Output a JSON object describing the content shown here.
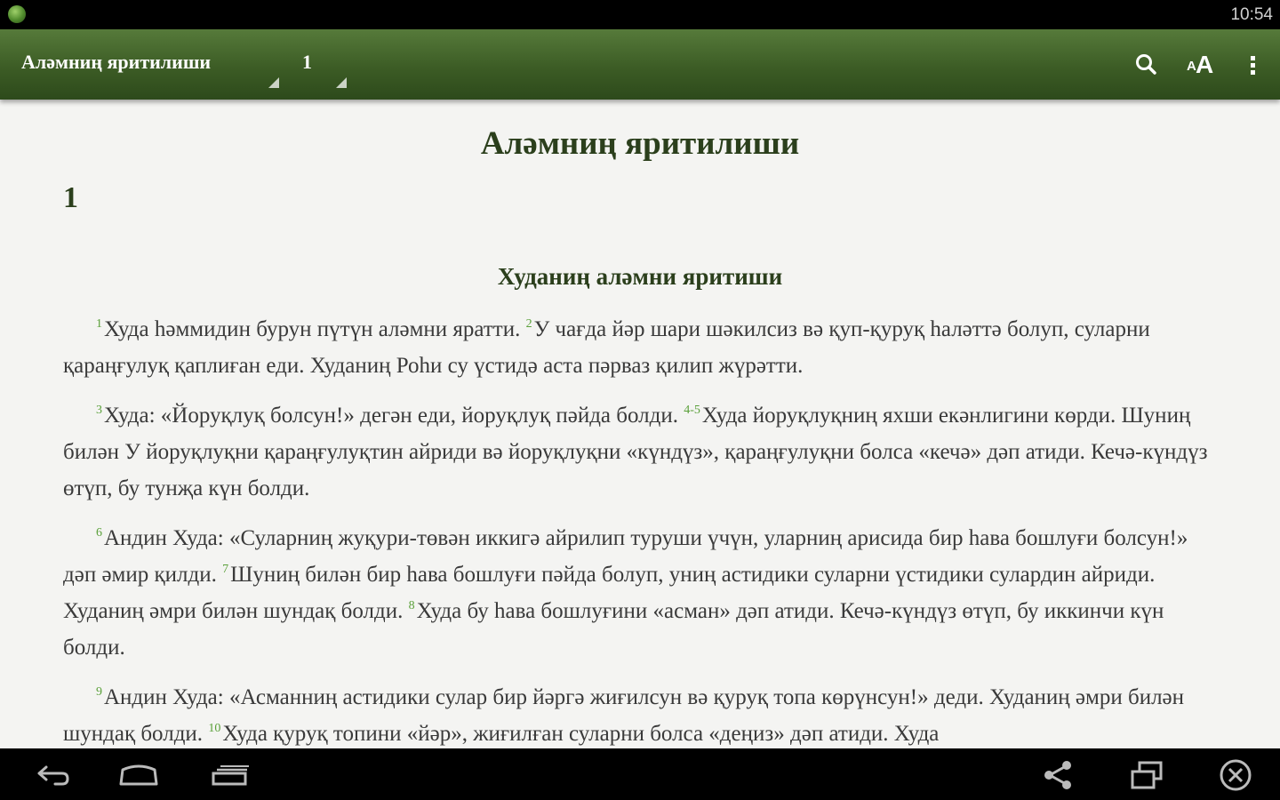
{
  "status_bar": {
    "time": "10:54"
  },
  "action_bar": {
    "book_selector": "Аләмниң яритилиши",
    "chapter_selector": "1"
  },
  "content": {
    "book_title": "Аләмниң яритилиши",
    "chapter": "1",
    "section_heading": "Худаниң аләмни яритиши",
    "paragraphs": [
      [
        {
          "v": "1",
          "t": "Худа һәммидин бурун пүтүн аләмни яратти. "
        },
        {
          "v": "2",
          "t": "У чағда йәр шари шәкилсиз вә қуп-қуруқ һаләттә болуп, суларни қараңғулуқ қаплиған еди. Худаниң Роһи су үстидә аста пәрваз қилип жүрәтти."
        }
      ],
      [
        {
          "v": "3",
          "t": "Худа: «Йоруқлуқ болсун!» дегән еди, йоруқлуқ пәйда болди. "
        },
        {
          "v": "4-5",
          "t": "Худа йоруқлуқниң яхши екәнлигини көрди. Шуниң билән У йоруқлуқни қараңғулуқтин айриди вә йоруқлуқни «күндүз», қараңғулуқни болса «кечә» дәп атиди. Кечә-күндүз өтүп, бу тунҗа күн болди."
        }
      ],
      [
        {
          "v": "6",
          "t": "Андин Худа: «Суларниң жуқури-төвән иккигә айрилип туруши үчүн, уларниң арисида бир һава бошлуғи болсун!» дәп әмир қилди. "
        },
        {
          "v": "7",
          "t": "Шуниң билән бир һава бошлуғи пәйда болуп, униң астидики суларни үстидики сулардин айриди. Худаниң әмри билән шундақ болди. "
        },
        {
          "v": "8",
          "t": "Худа бу һава бошлуғини «асман» дәп атиди. Кечә-күндүз өтүп, бу иккинчи күн болди."
        }
      ],
      [
        {
          "v": "9",
          "t": "Андин Худа: «Асманниң астидики сулар бир йәргә жиғилсун вә қуруқ топа көрүнсун!» деди. Худаниң әмри билән шундақ болди. "
        },
        {
          "v": "10",
          "t": "Худа қуруқ топини «йәр», жиғилған суларни болса «деңиз» дәп атиди. Худа"
        }
      ]
    ]
  },
  "icons": {
    "app": "app-icon",
    "search": "search-icon",
    "font_size": "font-size-icon",
    "overflow": "overflow-menu-icon",
    "back": "back-icon",
    "home": "home-icon",
    "recents": "recent-apps-icon",
    "share": "share-icon",
    "window": "window-icon",
    "close": "close-icon"
  },
  "colors": {
    "action_bar": "#3c5c25",
    "heading": "#2b3f1c",
    "verse_number": "#5aa03a",
    "background": "#f4f4f2"
  }
}
